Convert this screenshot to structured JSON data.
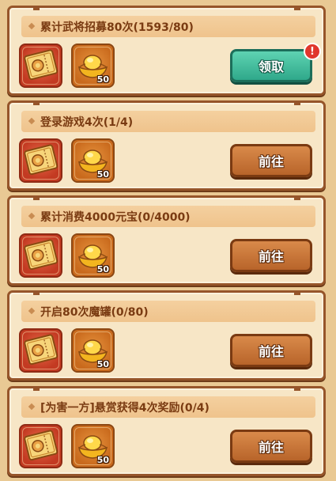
{
  "tasks": [
    {
      "title": "累计武将招募80次(1593/80)",
      "rewards": [
        {
          "icon": "ticket-icon",
          "qty": ""
        },
        {
          "icon": "gold-ingot-icon",
          "qty": "50"
        }
      ],
      "button": {
        "label": "领取",
        "type": "claim",
        "badge": "!"
      }
    },
    {
      "title": "登录游戏4次(1/4)",
      "rewards": [
        {
          "icon": "ticket-icon",
          "qty": ""
        },
        {
          "icon": "gold-ingot-icon",
          "qty": "50"
        }
      ],
      "button": {
        "label": "前往",
        "type": "go"
      }
    },
    {
      "title": "累计消费4000元宝(0/4000)",
      "rewards": [
        {
          "icon": "ticket-icon",
          "qty": ""
        },
        {
          "icon": "gold-ingot-icon",
          "qty": "50"
        }
      ],
      "button": {
        "label": "前往",
        "type": "go"
      }
    },
    {
      "title": "开启80次魔罐(0/80)",
      "rewards": [
        {
          "icon": "ticket-icon",
          "qty": ""
        },
        {
          "icon": "gold-ingot-icon",
          "qty": "50"
        }
      ],
      "button": {
        "label": "前往",
        "type": "go"
      }
    },
    {
      "title": "[为害一方]悬赏获得4次奖励(0/4)",
      "rewards": [
        {
          "icon": "ticket-icon",
          "qty": ""
        },
        {
          "icon": "gold-ingot-icon",
          "qty": "50"
        }
      ],
      "button": {
        "label": "前往",
        "type": "go"
      }
    }
  ],
  "colors": {
    "claim": "#2fa88a",
    "go": "#b8642a",
    "badge": "#e0362c",
    "title_text": "#7a3b12"
  }
}
